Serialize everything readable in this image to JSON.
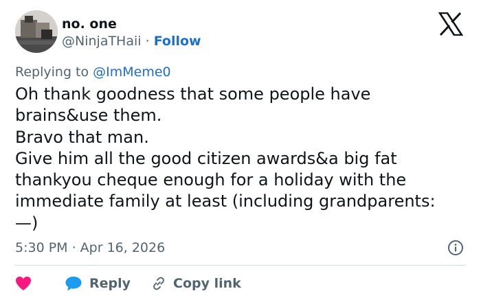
{
  "author": {
    "name": "no. one",
    "handle": "@NinjaTHaii",
    "separator": " · ",
    "follow_label": "Follow"
  },
  "reply_context": {
    "prefix": "Replying to ",
    "handle": "@ImMeme0"
  },
  "tweet": {
    "lines": [
      "Oh thank goodness that some people have",
      "brains&use them.",
      "Bravo that man.",
      "Give him all the good citizen awards&a big fat",
      "thankyou cheque enough for a holiday with the",
      "immediate family at least (including grandparents:",
      "—)"
    ],
    "timestamp": "5:30 PM · Apr 16, 2026"
  },
  "actions": {
    "reply_label": "Reply",
    "copy_link_label": "Copy link"
  },
  "icons": {
    "platform": "x-logo-icon",
    "info": "info-icon",
    "like": "heart-icon",
    "reply": "speech-bubble-icon",
    "copy": "link-icon"
  },
  "colors": {
    "link": "#1d6ecf",
    "secondary_text": "#536471",
    "heart": "#f91880",
    "reply_bubble": "#1d9bf0",
    "divider": "#cfd9de"
  }
}
